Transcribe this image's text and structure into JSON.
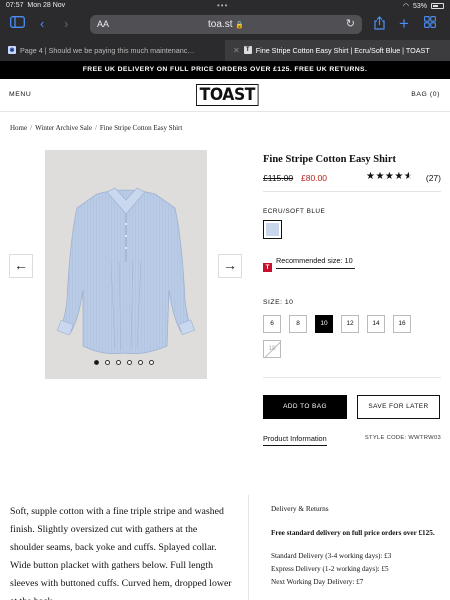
{
  "status_bar": {
    "time": "07:57",
    "date": "Mon 28 Nov",
    "battery": "53%"
  },
  "browser": {
    "text_size_label": "AA",
    "url": "toa.st",
    "tabs": [
      {
        "title": "Page 4 | Should we be paying this much maintenanc…"
      },
      {
        "title": "Fine Stripe Cotton Easy Shirt | Ecru/Soft Blue | TOAST"
      }
    ]
  },
  "promo_banner": "FREE UK DELIVERY ON FULL PRICE ORDERS OVER £125. FREE UK RETURNS.",
  "header": {
    "menu_label": "MENU",
    "logo": "TOAST",
    "bag_label": "BAG (0)"
  },
  "breadcrumb": [
    "Home",
    "Winter Archive Sale",
    "Fine Stripe Cotton Easy Shirt"
  ],
  "gallery": {
    "image_count": 6,
    "active_index": 0
  },
  "product": {
    "title": "Fine Stripe Cotton Easy Shirt",
    "old_price": "£115.00",
    "new_price": "£80.00",
    "rating": 4.5,
    "review_count": "(27)",
    "colour_label": "ECRU/SOFT BLUE",
    "swatch_color": "#c8d7ec",
    "recommended_size": "Recommended size: 10",
    "size_label": "SIZE: 10",
    "sizes": [
      "6",
      "8",
      "10",
      "12",
      "14",
      "16"
    ],
    "selected_size": "10",
    "soldout_size": "18",
    "add_to_bag": "ADD TO BAG",
    "save_for_later": "SAVE FOR LATER",
    "info_tab": "Product Information",
    "style_code": "STYLE CODE: WWTRW03"
  },
  "description": "Soft, supple cotton with a fine triple stripe and washed finish. Slightly oversized cut with gathers at the shoulder seams, back yoke and cuffs. Splayed collar. Wide button placket with gathers below. Full length sleeves with buttoned cuffs. Curved hem, dropped lower at the back.",
  "delivery": {
    "heading": "Delivery & Returns",
    "free_note": "Free standard delivery on full price orders over £125.",
    "standard": "Standard Delivery (3-4 working days): £3",
    "express": "Express Delivery (1-2 working days): £5",
    "next_day": "Next Working Day Delivery: £7"
  },
  "colors": {
    "sale_red": "#b0241b",
    "brand_red": "#c8102e",
    "safari_blue": "#4a8ff7"
  }
}
